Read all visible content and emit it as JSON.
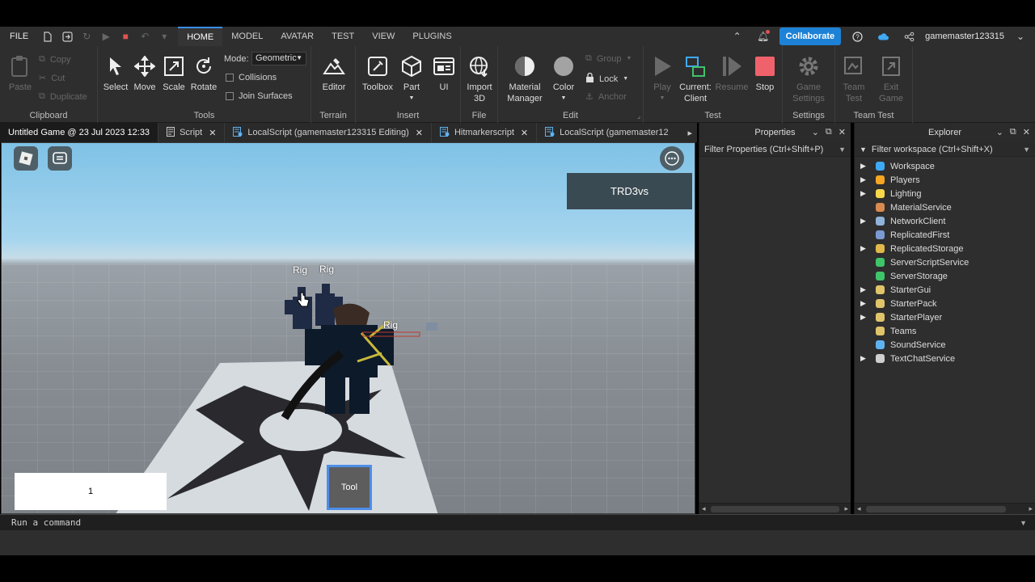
{
  "menubar": {
    "file": "FILE",
    "tabs": [
      "HOME",
      "MODEL",
      "AVATAR",
      "TEST",
      "VIEW",
      "PLUGINS"
    ],
    "active_tab": "HOME",
    "collaborate": "Collaborate",
    "username": "gamemaster123315"
  },
  "ribbon": {
    "clipboard": {
      "label": "Clipboard",
      "paste": "Paste",
      "copy": "Copy",
      "cut": "Cut",
      "duplicate": "Duplicate"
    },
    "tools": {
      "label": "Tools",
      "select": "Select",
      "move": "Move",
      "scale": "Scale",
      "rotate": "Rotate",
      "mode_label": "Mode:",
      "mode_value": "Geometric",
      "collisions": "Collisions",
      "join_surfaces": "Join Surfaces"
    },
    "terrain": {
      "label": "Terrain",
      "editor": "Editor"
    },
    "insert": {
      "label": "Insert",
      "toolbox": "Toolbox",
      "part": "Part",
      "ui": "UI"
    },
    "file": {
      "label": "File",
      "import3d_1": "Import",
      "import3d_2": "3D"
    },
    "edit": {
      "label": "Edit",
      "material_1": "Material",
      "material_2": "Manager",
      "color": "Color",
      "group": "Group",
      "lock": "Lock",
      "anchor": "Anchor"
    },
    "test": {
      "label": "Test",
      "play": "Play",
      "current_1": "Current:",
      "current_2": "Client",
      "resume": "Resume",
      "stop": "Stop"
    },
    "settings": {
      "label": "Settings",
      "game_1": "Game",
      "game_2": "Settings"
    },
    "team_test": {
      "label": "Team Test",
      "team_1": "Team",
      "team_2": "Test",
      "exit_1": "Exit",
      "exit_2": "Game"
    }
  },
  "doc_tabs": [
    {
      "label": "Untitled Game @ 23 Jul 2023 12:33"
    },
    {
      "label": "Script"
    },
    {
      "label": "LocalScript (gamemaster123315 Editing)"
    },
    {
      "label": "Hitmarkerscript"
    },
    {
      "label": "LocalScript (gamemaster12"
    }
  ],
  "viewport": {
    "trd_label": "TRD3vs",
    "rig_labels": [
      "Rig",
      "Rig",
      "Rig"
    ],
    "score": "1",
    "tool": "Tool"
  },
  "properties": {
    "title": "Properties",
    "filter": "Filter Properties (Ctrl+Shift+P)"
  },
  "explorer": {
    "title": "Explorer",
    "filter": "Filter workspace (Ctrl+Shift+X)",
    "items": [
      {
        "label": "Workspace",
        "icon": "workspace-icon",
        "color": "#3fa9f5",
        "expandable": true
      },
      {
        "label": "Players",
        "icon": "players-icon",
        "color": "#f5a623",
        "expandable": true
      },
      {
        "label": "Lighting",
        "icon": "lightbulb-icon",
        "color": "#f8d84a",
        "expandable": true
      },
      {
        "label": "MaterialService",
        "icon": "material-service-icon",
        "color": "#d98a4e",
        "expandable": false
      },
      {
        "label": "NetworkClient",
        "icon": "network-icon",
        "color": "#8fb3d9",
        "expandable": true
      },
      {
        "label": "ReplicatedFirst",
        "icon": "replicated-first-icon",
        "color": "#7b9ad1",
        "expandable": false
      },
      {
        "label": "ReplicatedStorage",
        "icon": "replicated-storage-icon",
        "color": "#e0b84b",
        "expandable": true
      },
      {
        "label": "ServerScriptService",
        "icon": "server-script-icon",
        "color": "#3fc46a",
        "expandable": false
      },
      {
        "label": "ServerStorage",
        "icon": "server-storage-icon",
        "color": "#3fc46a",
        "expandable": false
      },
      {
        "label": "StarterGui",
        "icon": "folder-icon",
        "color": "#e0c46a",
        "expandable": true
      },
      {
        "label": "StarterPack",
        "icon": "folder-icon",
        "color": "#e0c46a",
        "expandable": true
      },
      {
        "label": "StarterPlayer",
        "icon": "folder-icon",
        "color": "#e0c46a",
        "expandable": true
      },
      {
        "label": "Teams",
        "icon": "folder-icon",
        "color": "#e0c46a",
        "expandable": false
      },
      {
        "label": "SoundService",
        "icon": "sound-icon",
        "color": "#5fb2f0",
        "expandable": false
      },
      {
        "label": "TextChatService",
        "icon": "chat-icon",
        "color": "#cfcfcf",
        "expandable": true
      }
    ]
  },
  "command_bar": {
    "placeholder": "Run a command"
  }
}
